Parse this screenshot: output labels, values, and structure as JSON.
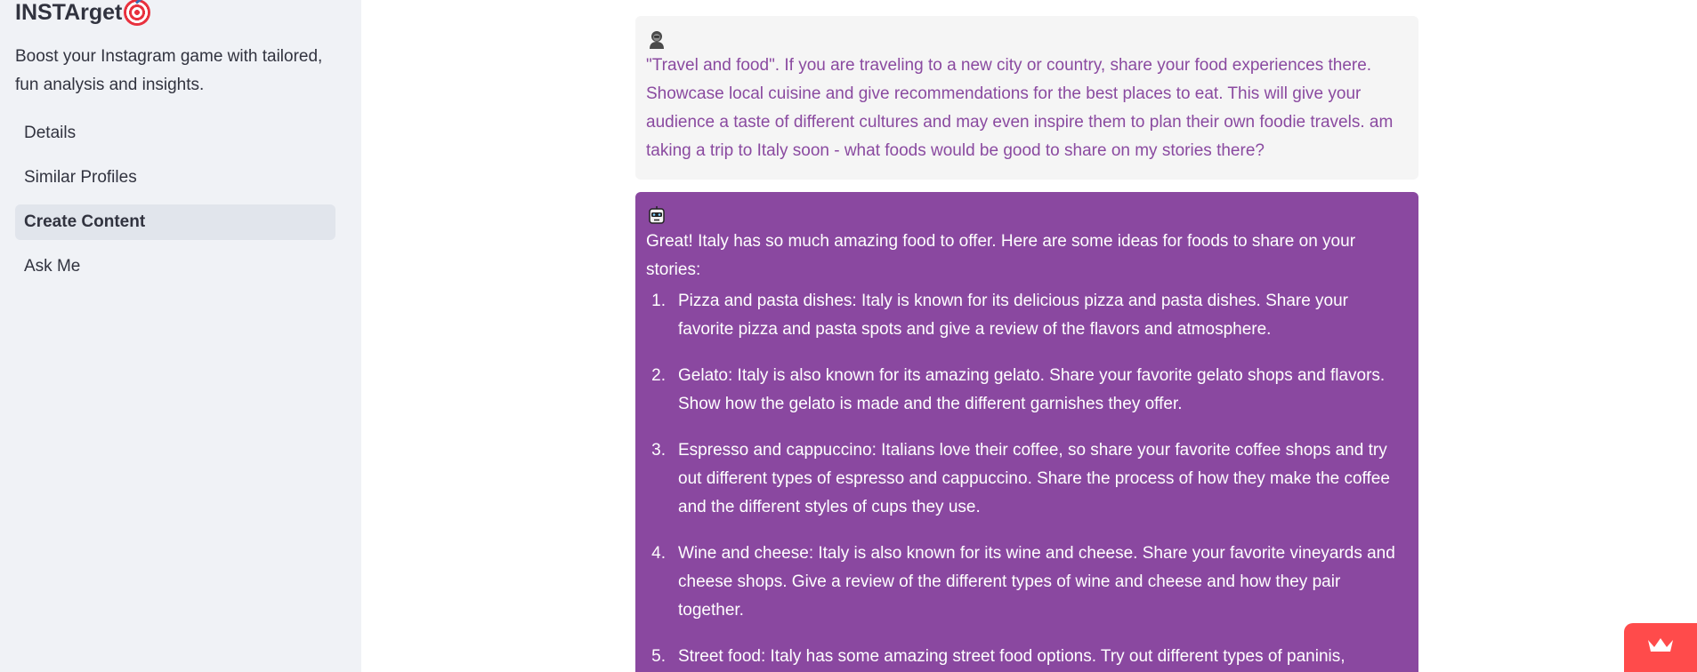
{
  "sidebar": {
    "app_title": "INSTArget",
    "app_title_icon": "target-icon",
    "subtitle": "Boost your Instagram game with tailored, fun analysis and insights.",
    "nav_items": [
      {
        "label": "Details",
        "active": false
      },
      {
        "label": "Similar Profiles",
        "active": false
      },
      {
        "label": "Create Content",
        "active": true
      },
      {
        "label": "Ask Me",
        "active": false
      }
    ]
  },
  "chat": {
    "user_message": {
      "avatar_icon": "user-avatar-icon",
      "text": "\"Travel and food\". If you are traveling to a new city or country, share your food experiences there. Showcase local cuisine and give recommendations for the best places to eat. This will give your audience a taste of different cultures and may even inspire them to plan their own foodie travels. am taking a trip to Italy soon - what foods would be good to share on my stories there?"
    },
    "bot_message": {
      "avatar_icon": "bot-avatar-icon",
      "intro": "Great! Italy has so much amazing food to offer. Here are some ideas for foods to share on your stories:",
      "items": [
        {
          "num": "1.",
          "text": "Pizza and pasta dishes: Italy is known for its delicious pizza and pasta dishes. Share your favorite pizza and pasta spots and give a review of the flavors and atmosphere."
        },
        {
          "num": "2.",
          "text": "Gelato: Italy is also known for its amazing gelato. Share your favorite gelato shops and flavors. Show how the gelato is made and the different garnishes they offer."
        },
        {
          "num": "3.",
          "text": "Espresso and cappuccino: Italians love their coffee, so share your favorite coffee shops and try out different types of espresso and cappuccino. Share the process of how they make the coffee and the different styles of cups they use."
        },
        {
          "num": "4.",
          "text": "Wine and cheese: Italy is also known for its wine and cheese. Share your favorite vineyards and cheese shops. Give a review of the different types of wine and cheese and how they pair together."
        },
        {
          "num": "5.",
          "text": "Street food: Italy has some amazing street food options. Try out different types of paninis, arancinis, and other local specialties. Show how they are made and give a review of the flavors."
        }
      ]
    }
  },
  "badge": {
    "icon": "crown-icon"
  },
  "colors": {
    "sidebar_bg": "#f0f2f6",
    "user_msg_bg": "#f5f5f5",
    "user_text": "#8a4aa0",
    "bot_msg_bg": "#8a48a0",
    "badge_bg": "#ff4b4b"
  }
}
